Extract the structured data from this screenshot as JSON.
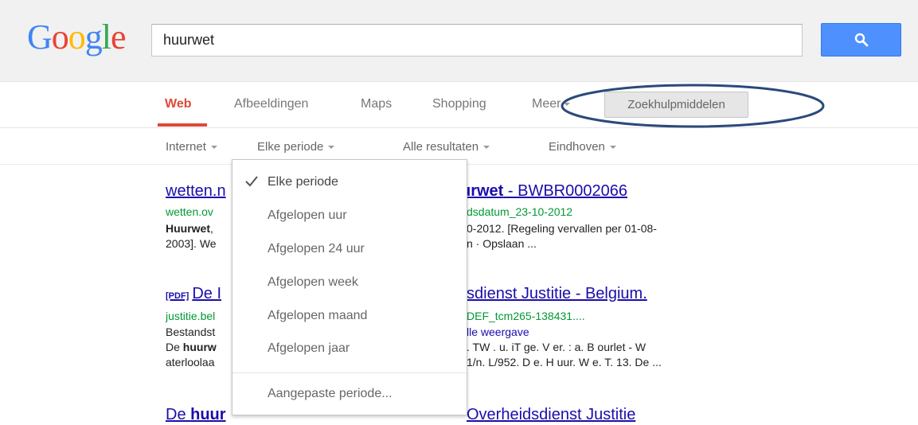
{
  "logo": {
    "text": "Google"
  },
  "search": {
    "value": "huurwet"
  },
  "nav": {
    "tabs": [
      {
        "label": "Web",
        "active": true
      },
      {
        "label": "Afbeeldingen"
      },
      {
        "label": "Maps"
      },
      {
        "label": "Shopping"
      },
      {
        "label": "Meer"
      }
    ],
    "tools_label": "Zoekhulpmiddelen"
  },
  "filters": {
    "internet": "Internet",
    "period": "Elke periode",
    "results": "Alle resultaten",
    "location": "Eindhoven"
  },
  "dropdown": {
    "items": [
      {
        "label": "Elke periode",
        "selected": true
      },
      {
        "label": "Afgelopen uur"
      },
      {
        "label": "Afgelopen 24 uur"
      },
      {
        "label": "Afgelopen week"
      },
      {
        "label": "Afgelopen maand"
      },
      {
        "label": "Afgelopen jaar"
      }
    ],
    "custom": "Aangepaste periode..."
  },
  "results": [
    {
      "title_left": "wetten.n",
      "title_bold": "urwet",
      "title_right": " - BWBR0002066",
      "url_left": "wetten.ov",
      "url_right": "dsdatum_23-10-2012",
      "snippet1_bold": "Huurwet",
      "snippet1_left": ",",
      "snippet1_right": "0-2012. [Regeling vervallen per 01-08-",
      "snippet2_left": "2003]. We",
      "snippet2_right": "n · Opslaan ..."
    },
    {
      "pdf_tag": "[PDF]",
      "title_left": "De I",
      "title_right": "sdienst Justitie - Belgium.",
      "url_left": "justitie.bel",
      "url_right": "DEF_tcm265-138431....",
      "snippet1_left": "Bestandst",
      "snippet1_right": "lle weergave",
      "snippet2_left": "De ",
      "snippet2_bold": "huurw",
      "snippet2_right": ". TW . u. iT ge. V er. : a. B ourlet - W",
      "snippet3_left": "aterloolaa",
      "snippet3_right": "1/n. L/952. D e. H uur. W e. T. 13. De ..."
    },
    {
      "title_left": "De ",
      "title_bold": "huur",
      "title_mid": "....; ..... ...... . .....",
      "title_right": "Overheidsdienst Justitie"
    }
  ]
}
